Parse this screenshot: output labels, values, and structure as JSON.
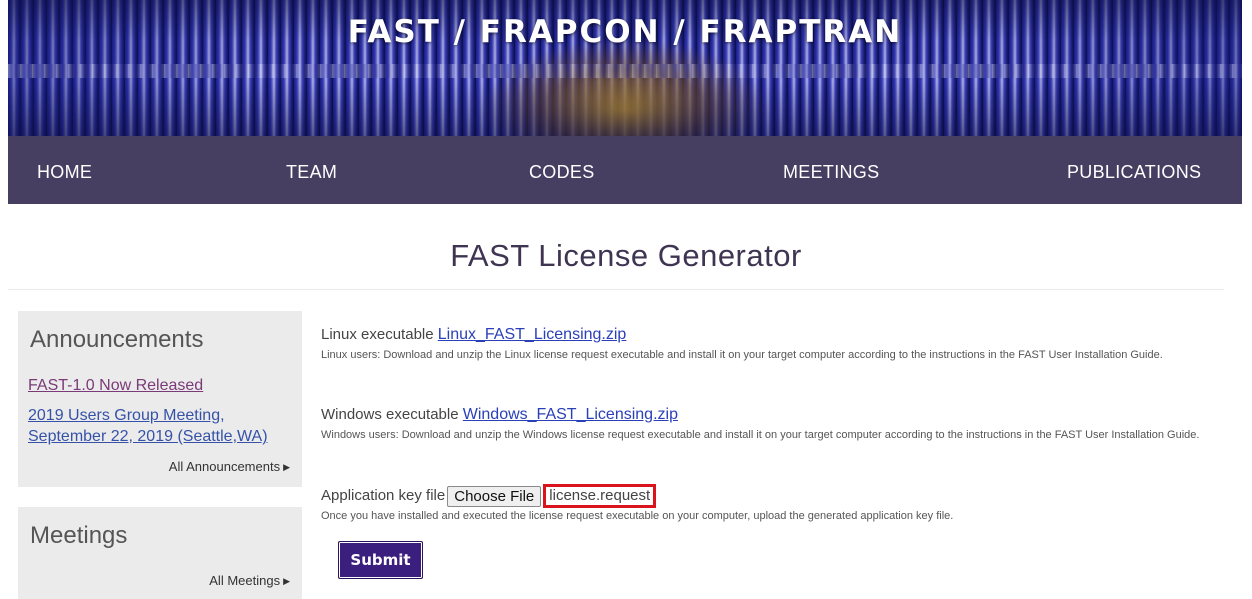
{
  "banner": {
    "title": "FAST / FRAPCON / FRAPTRAN"
  },
  "nav": {
    "items": [
      {
        "label": "HOME"
      },
      {
        "label": "TEAM"
      },
      {
        "label": "CODES"
      },
      {
        "label": "MEETINGS"
      },
      {
        "label": "PUBLICATIONS"
      }
    ]
  },
  "page": {
    "title": "FAST License Generator"
  },
  "sidebar": {
    "announcements": {
      "heading": "Announcements",
      "links": [
        {
          "label": "FAST-1.0 Now Released"
        },
        {
          "label": "2019 Users Group Meeting, September 22, 2019 (Seattle,WA)"
        }
      ],
      "more_label": "All Announcements",
      "more_icon": "triangle-right-icon"
    },
    "meetings": {
      "heading": "Meetings",
      "more_label": "All Meetings",
      "more_icon": "triangle-right-icon"
    }
  },
  "main": {
    "linux": {
      "label": "Linux executable",
      "link": "Linux_FAST_Licensing.zip",
      "help": "Linux users: Download and unzip the Linux license request executable and install it on your target computer according to the instructions in the FAST User Installation Guide."
    },
    "windows": {
      "label": "Windows executable",
      "link": "Windows_FAST_Licensing.zip",
      "help": "Windows users: Download and unzip the Windows license request executable and install it on your target computer according to the instructions in the FAST User Installation Guide."
    },
    "upload": {
      "label": "Application key file",
      "choose_label": "Choose File",
      "file_name": "license.request",
      "help": "Once you have installed and executed the license request executable on your computer, upload the generated application key file."
    },
    "submit_label": "Submit"
  },
  "colors": {
    "nav_bg": "#463f62",
    "title": "#3f3452",
    "link": "#3552a8",
    "visited_link": "#7a3a78",
    "submit_bg": "#3b1f7e",
    "highlight": "#d9141d",
    "sidebar_bg": "#ebebeb"
  }
}
